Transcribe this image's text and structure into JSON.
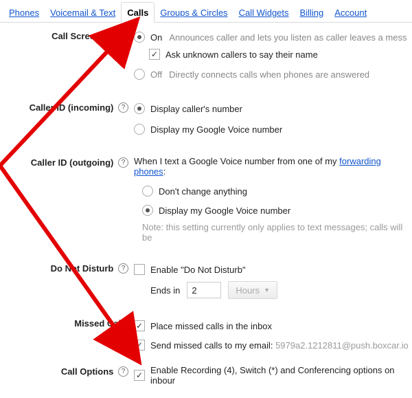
{
  "tabs": {
    "phones": "Phones",
    "voicemail": "Voicemail & Text",
    "calls": "Calls",
    "groups": "Groups & Circles",
    "widgets": "Call Widgets",
    "billing": "Billing",
    "account": "Account"
  },
  "screening": {
    "label": "Call Screening",
    "on": "On",
    "on_desc": "Announces caller and lets you listen as caller leaves a mess",
    "ask": "Ask unknown callers to say their name",
    "off": "Off",
    "off_desc": "Directly connects calls when phones are answered"
  },
  "cid_in": {
    "label": "Caller ID (incoming)",
    "opt1": "Display caller's number",
    "opt2": "Display my Google Voice number"
  },
  "cid_out": {
    "label": "Caller ID (outgoing)",
    "prefix": "When I text a Google Voice number from one of my ",
    "link": "forwarding phones",
    "suffix": ":",
    "opt1": "Don't change anything",
    "opt2": "Display my Google Voice number",
    "note": "Note: this setting currently only applies to text messages; calls will be"
  },
  "dnd": {
    "label": "Do Not Disturb",
    "enable": "Enable \"Do Not Disturb\"",
    "ends_in": "Ends in",
    "value": "2",
    "unit": "Hours"
  },
  "missed": {
    "label": "Missed Calls",
    "opt1": "Place missed calls in the inbox",
    "opt2_prefix": "Send missed calls to my email: ",
    "email": "5979a2.1212811@push.boxcar.io"
  },
  "options": {
    "label": "Call Options",
    "enable": "Enable Recording (4), Switch (*) and Conferencing options on inbour"
  }
}
